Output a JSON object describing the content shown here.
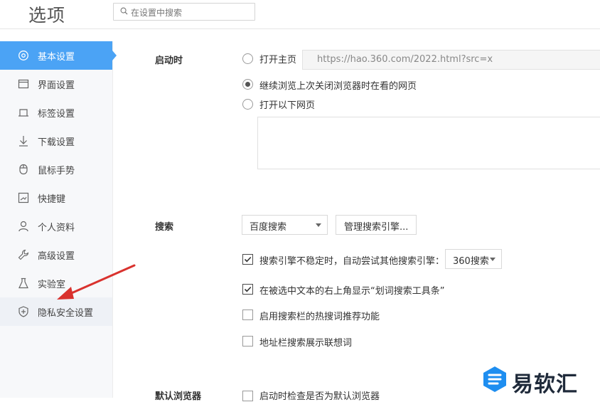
{
  "header": {
    "title": "选项",
    "search_placeholder": "在设置中搜索"
  },
  "sidebar": {
    "items": [
      {
        "label": "基本设置",
        "icon": "gear-icon",
        "active": true
      },
      {
        "label": "界面设置",
        "icon": "window-icon"
      },
      {
        "label": "标签设置",
        "icon": "tab-icon"
      },
      {
        "label": "下载设置",
        "icon": "download-icon"
      },
      {
        "label": "鼠标手势",
        "icon": "mouse-icon"
      },
      {
        "label": "快捷键",
        "icon": "keyboard-icon"
      },
      {
        "label": "个人资料",
        "icon": "user-icon"
      },
      {
        "label": "高级设置",
        "icon": "wrench-icon"
      },
      {
        "label": "实验室",
        "icon": "flask-icon"
      },
      {
        "label": "隐私安全设置",
        "icon": "shield-icon",
        "hover": true
      }
    ]
  },
  "startup": {
    "title": "启动时",
    "options": [
      {
        "label": "打开主页",
        "selected": false
      },
      {
        "label": "继续浏览上次关闭浏览器时在看的网页",
        "selected": true
      },
      {
        "label": "打开以下网页",
        "selected": false
      }
    ],
    "homepage_url": "https://hao.360.com/2022.html?src=x"
  },
  "search": {
    "title": "搜索",
    "engine_selected": "百度搜索",
    "manage_button": "管理搜索引擎...",
    "options": [
      {
        "label": "搜索引擎不稳定时，自动尝试其他搜索引擎：",
        "checked": true,
        "fallback_select": "360搜索"
      },
      {
        "label": "在被选中文本的右上角显示“划词搜索工具条”",
        "checked": true
      },
      {
        "label": "启用搜索栏的热搜词推荐功能",
        "checked": false
      },
      {
        "label": "地址栏搜索展示联想词",
        "checked": false
      }
    ]
  },
  "default_browser": {
    "title": "默认浏览器",
    "option_label": "启动时检查是否为默认浏览器"
  },
  "watermark": {
    "text": "易软汇"
  },
  "colors": {
    "accent": "#4ba3f5",
    "arrow": "#d9322e",
    "watermark_blue": "#1e8ef0"
  }
}
